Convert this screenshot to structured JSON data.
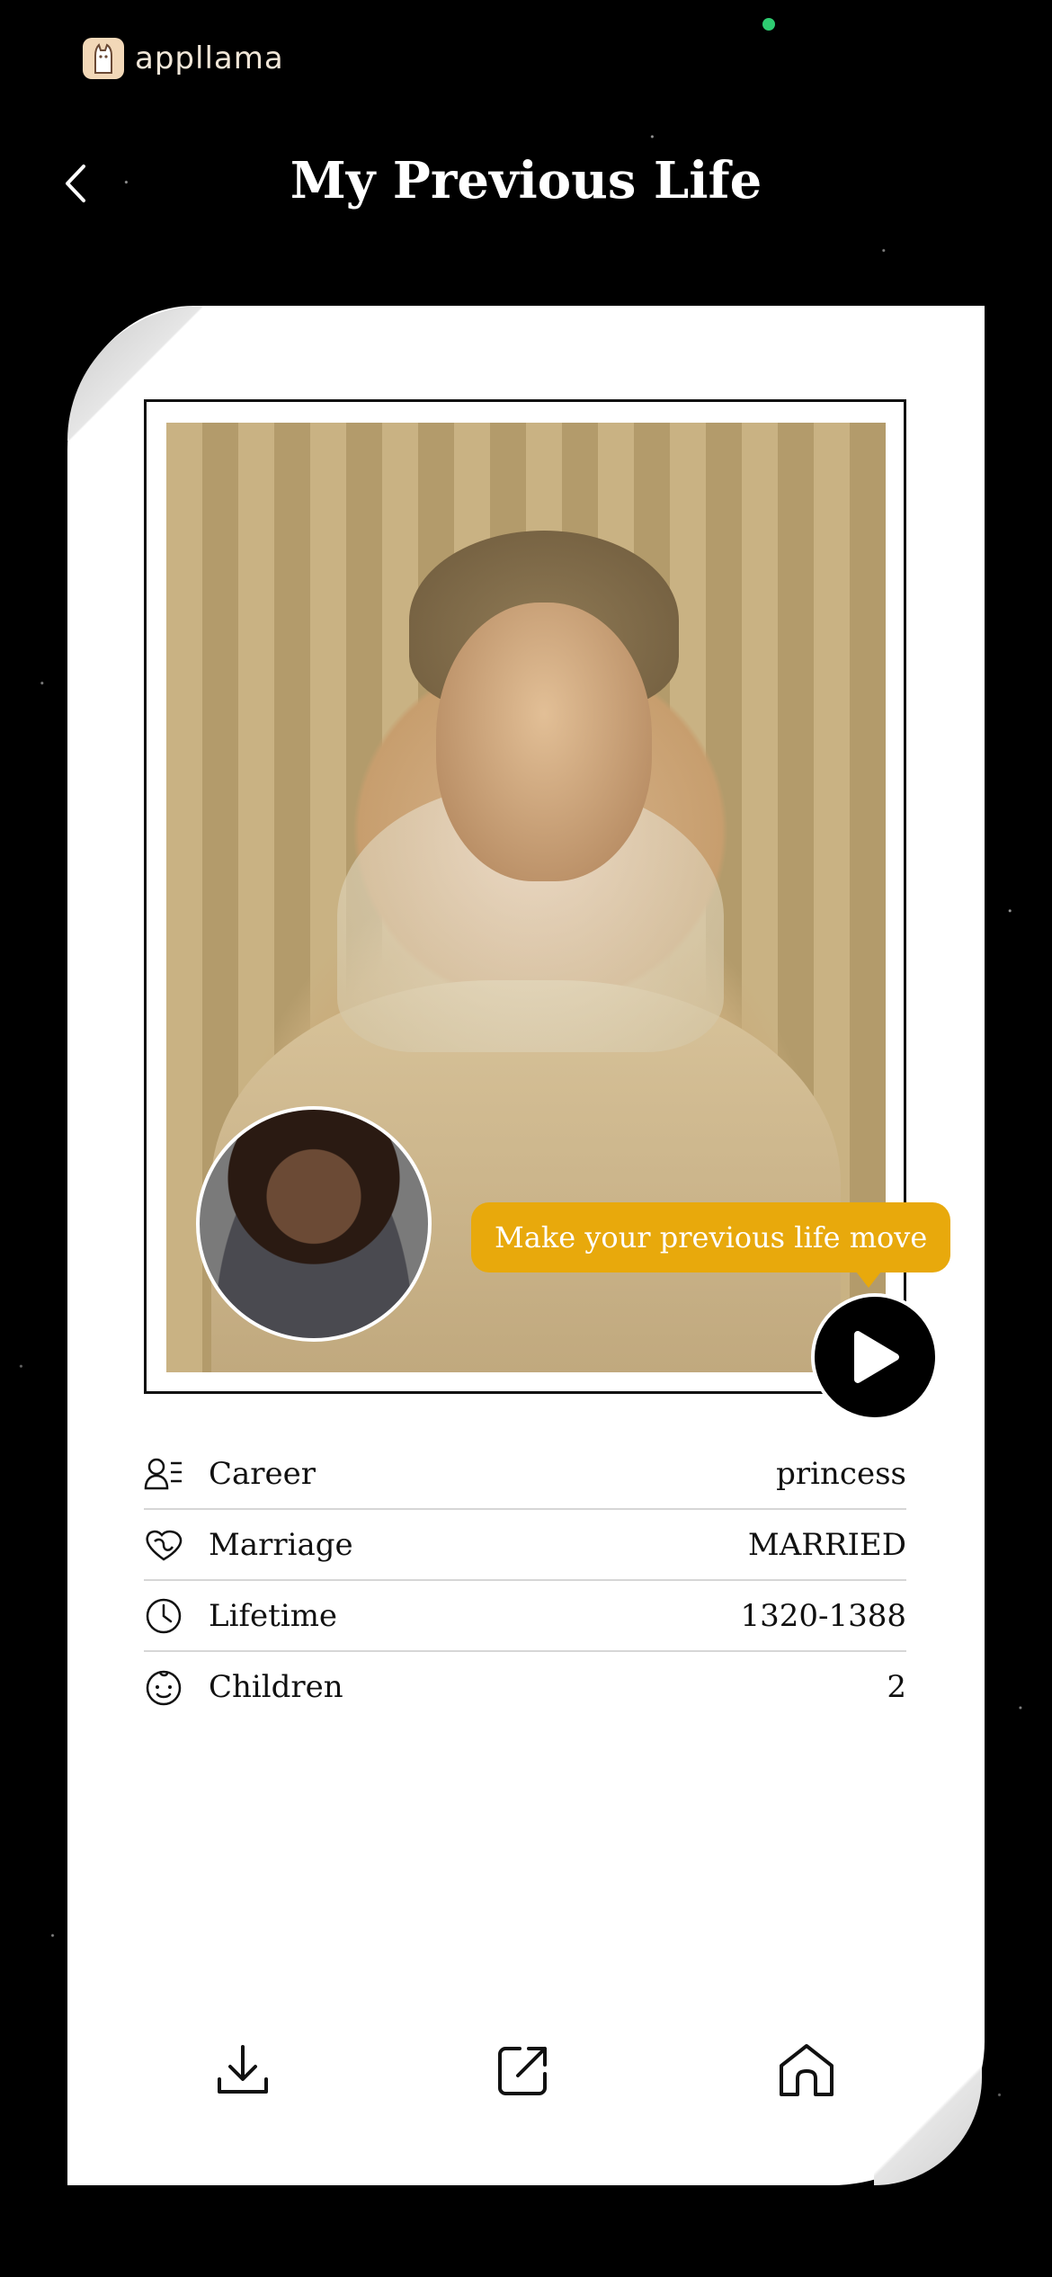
{
  "status": {
    "indicator_color": "#2ecc71"
  },
  "brand": {
    "name": "appllama",
    "logo_icon": "llama-logo-icon"
  },
  "header": {
    "title": "My Previous Life",
    "back_icon": "chevron-left-icon"
  },
  "card": {
    "portrait_alt": "previous-life-portrait",
    "avatar_alt": "user-photo",
    "tooltip": "Make your previous life move",
    "tooltip_color": "#e8a90c",
    "play_icon": "play-icon"
  },
  "info": [
    {
      "icon": "career-icon",
      "label": "Career",
      "value": "princess"
    },
    {
      "icon": "marriage-icon",
      "label": "Marriage",
      "value": "MARRIED"
    },
    {
      "icon": "clock-icon",
      "label": "Lifetime",
      "value": "1320-1388"
    },
    {
      "icon": "baby-face-icon",
      "label": "Children",
      "value": "2"
    }
  ],
  "bottom_bar": [
    {
      "icon": "download-icon"
    },
    {
      "icon": "share-icon"
    },
    {
      "icon": "home-icon"
    }
  ]
}
